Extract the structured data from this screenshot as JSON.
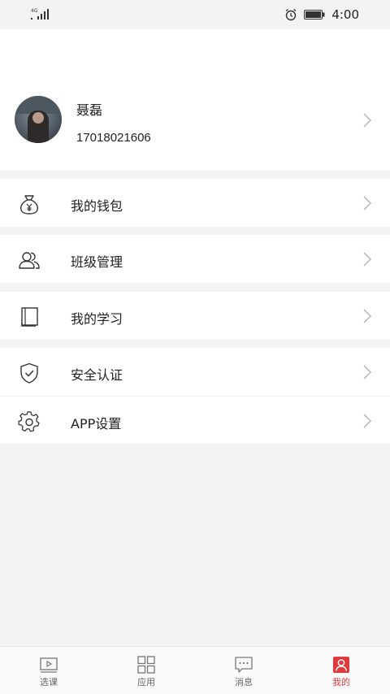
{
  "status_bar": {
    "network": "4G",
    "time": "4:00"
  },
  "profile": {
    "name": "聂磊",
    "phone": "17018021606"
  },
  "menu": {
    "wallet": "我的钱包",
    "class_manage": "班级管理",
    "my_study": "我的学习",
    "security": "安全认证",
    "app_settings": "APP设置"
  },
  "tabs": [
    {
      "label": "选课",
      "icon": "play-video-icon"
    },
    {
      "label": "应用",
      "icon": "grid-apps-icon"
    },
    {
      "label": "消息",
      "icon": "message-bubble-icon"
    },
    {
      "label": "我的",
      "icon": "user-profile-icon"
    }
  ],
  "active_tab": 3,
  "colors": {
    "accent": "#e0393e",
    "background": "#f3f3f3"
  }
}
